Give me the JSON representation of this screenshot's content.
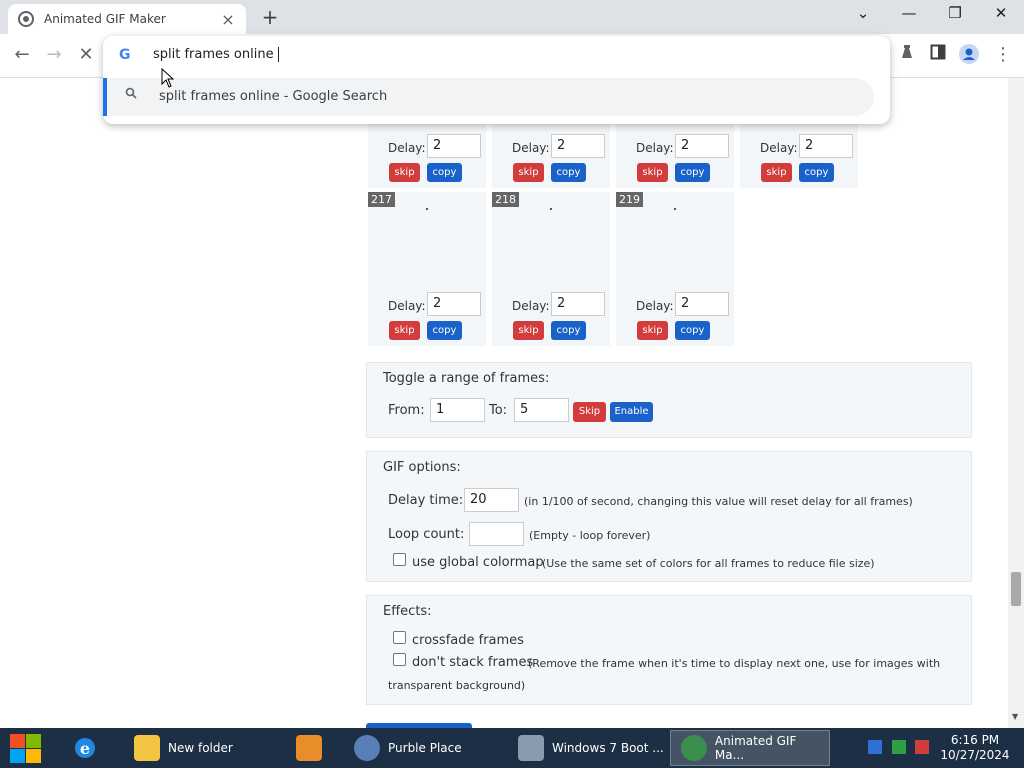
{
  "browser": {
    "tab_title": "Animated GIF Maker",
    "tab_close": "×",
    "new_tab": "+",
    "minimize": "—",
    "chevron": "⌄",
    "restore": "❐",
    "close": "✕",
    "back": "←",
    "forward": "→",
    "stop": "✕",
    "omnibox_text": "split frames online",
    "suggestion_text": "split frames online - Google Search"
  },
  "frames_top_row": [
    {
      "delay": "2",
      "skip": "skip",
      "copy": "copy"
    },
    {
      "delay": "2",
      "skip": "skip",
      "copy": "copy"
    },
    {
      "delay": "2",
      "skip": "skip",
      "copy": "copy"
    },
    {
      "delay": "2",
      "skip": "skip",
      "copy": "copy"
    }
  ],
  "frames_bottom_row": [
    {
      "number": "217",
      "delay": "2",
      "skip": "skip",
      "copy": "copy"
    },
    {
      "number": "218",
      "delay": "2",
      "skip": "skip",
      "copy": "copy"
    },
    {
      "number": "219",
      "delay": "2",
      "skip": "skip",
      "copy": "copy"
    }
  ],
  "delay_label": "Delay:",
  "toggle_range": {
    "title": "Toggle a range of frames:",
    "from_label": "From:",
    "from_value": "1",
    "to_label": "To:",
    "to_value": "5",
    "skip_label": "Skip",
    "enable_label": "Enable"
  },
  "gif_options": {
    "title": "GIF options:",
    "delay_label": "Delay time:",
    "delay_value": "20",
    "delay_note": "(in 1/100 of second, changing this value will reset delay for all frames)",
    "loop_label": "Loop count:",
    "loop_value": "",
    "loop_note": "(Empty - loop forever)",
    "colormap_label": "use global colormap",
    "colormap_note": "(Use the same set of colors for all frames to reduce file size)"
  },
  "effects": {
    "title": "Effects:",
    "crossfade_label": "crossfade frames",
    "nostack_label": "don't stack frames",
    "nostack_note": "(Remove the frame when it's time to display next one, use for images with",
    "nostack_note2": "transparent background)"
  },
  "taskbar": {
    "items": [
      "New folder",
      "Purble Place",
      "Windows 7 Boot ...",
      "Animated GIF Ma..."
    ],
    "time": "6:16 PM",
    "date": "10/27/2024"
  },
  "colors": {
    "skip_red": "#d33c3c",
    "copy_blue": "#1a62c9",
    "taskbar": "#1c2f44"
  }
}
